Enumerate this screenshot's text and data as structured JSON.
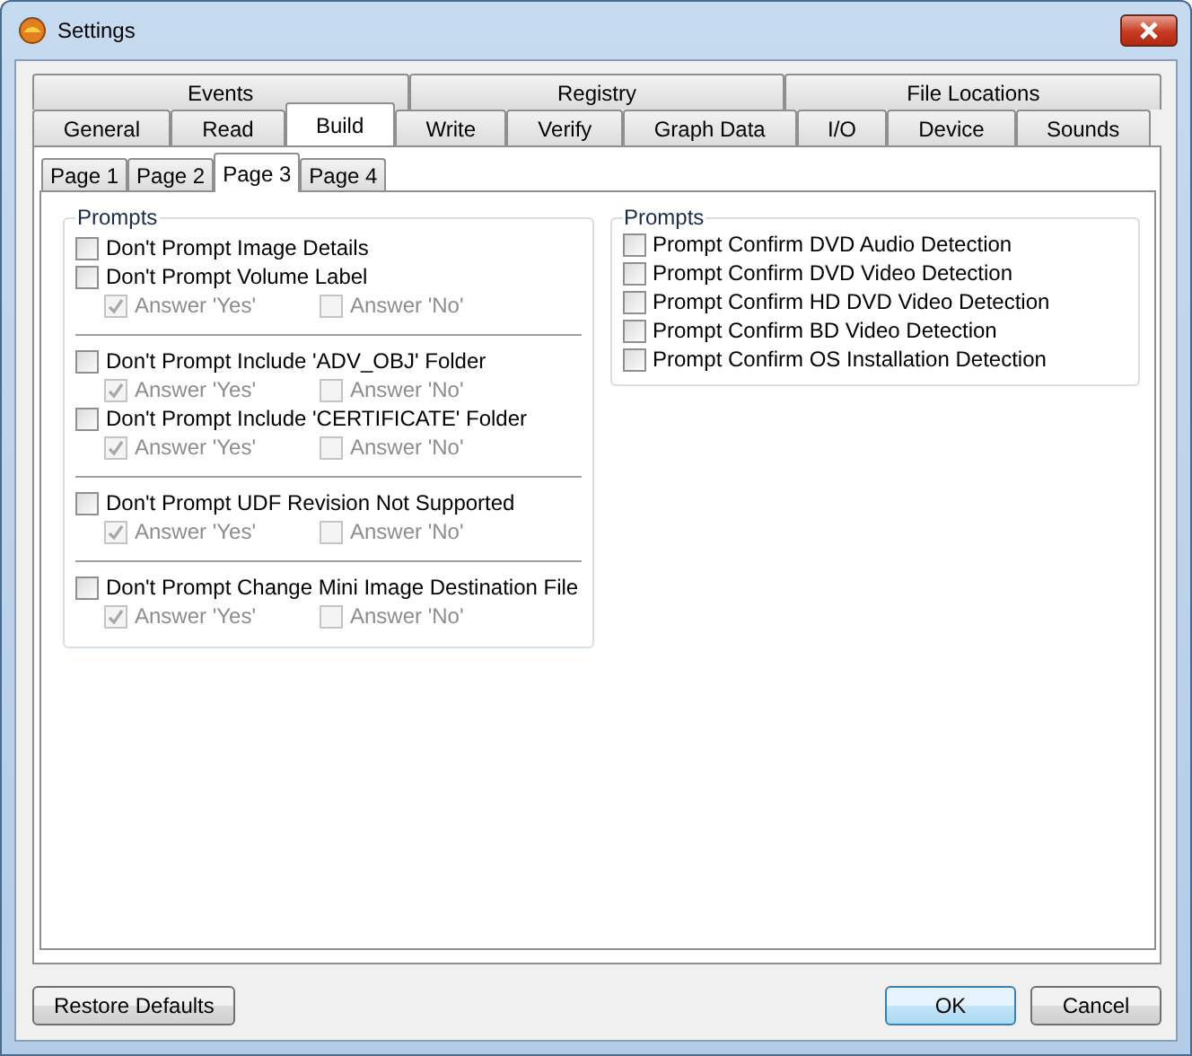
{
  "window": {
    "title": "Settings"
  },
  "tab_rows": [
    [
      {
        "label": "Events",
        "selected": false
      },
      {
        "label": "Registry",
        "selected": false
      },
      {
        "label": "File Locations",
        "selected": false
      }
    ],
    [
      {
        "label": "General",
        "selected": false
      },
      {
        "label": "Read",
        "selected": false
      },
      {
        "label": "Build",
        "selected": true
      },
      {
        "label": "Write",
        "selected": false
      },
      {
        "label": "Verify",
        "selected": false
      },
      {
        "label": "Graph Data",
        "selected": false
      },
      {
        "label": "I/O",
        "selected": false
      },
      {
        "label": "Device",
        "selected": false
      },
      {
        "label": "Sounds",
        "selected": false
      }
    ]
  ],
  "page_tabs": [
    {
      "label": "Page 1",
      "selected": false
    },
    {
      "label": "Page 2",
      "selected": false
    },
    {
      "label": "Page 3",
      "selected": true
    },
    {
      "label": "Page 4",
      "selected": false
    }
  ],
  "left_group": {
    "title": "Prompts",
    "sections": [
      [
        {
          "label": "Don't Prompt Image Details",
          "checked": false
        },
        {
          "label": "Don't Prompt Volume Label",
          "checked": false,
          "answers": [
            {
              "label": "Answer 'Yes'",
              "checked": true,
              "disabled": true
            },
            {
              "label": "Answer 'No'",
              "checked": false,
              "disabled": true
            }
          ]
        }
      ],
      [
        {
          "label": "Don't Prompt Include 'ADV_OBJ' Folder",
          "checked": false,
          "answers": [
            {
              "label": "Answer 'Yes'",
              "checked": true,
              "disabled": true
            },
            {
              "label": "Answer 'No'",
              "checked": false,
              "disabled": true
            }
          ]
        },
        {
          "label": "Don't Prompt Include 'CERTIFICATE' Folder",
          "checked": false,
          "answers": [
            {
              "label": "Answer 'Yes'",
              "checked": true,
              "disabled": true
            },
            {
              "label": "Answer 'No'",
              "checked": false,
              "disabled": true
            }
          ]
        }
      ],
      [
        {
          "label": "Don't Prompt UDF Revision Not Supported",
          "checked": false,
          "answers": [
            {
              "label": "Answer 'Yes'",
              "checked": true,
              "disabled": true
            },
            {
              "label": "Answer 'No'",
              "checked": false,
              "disabled": true
            }
          ]
        }
      ],
      [
        {
          "label": "Don't Prompt Change Mini Image Destination File",
          "checked": false,
          "answers": [
            {
              "label": "Answer 'Yes'",
              "checked": true,
              "disabled": true
            },
            {
              "label": "Answer 'No'",
              "checked": false,
              "disabled": true
            }
          ]
        }
      ]
    ]
  },
  "right_group": {
    "title": "Prompts",
    "items": [
      {
        "label": "Prompt Confirm DVD Audio Detection",
        "checked": false
      },
      {
        "label": "Prompt Confirm DVD Video Detection",
        "checked": false
      },
      {
        "label": "Prompt Confirm HD DVD Video Detection",
        "checked": false
      },
      {
        "label": "Prompt Confirm BD Video Detection",
        "checked": false
      },
      {
        "label": "Prompt Confirm OS Installation Detection",
        "checked": false
      }
    ]
  },
  "buttons": {
    "left": [
      {
        "label": "Restore Defaults",
        "default": false
      }
    ],
    "right": [
      {
        "label": "OK",
        "default": true
      },
      {
        "label": "Cancel",
        "default": false
      }
    ]
  }
}
